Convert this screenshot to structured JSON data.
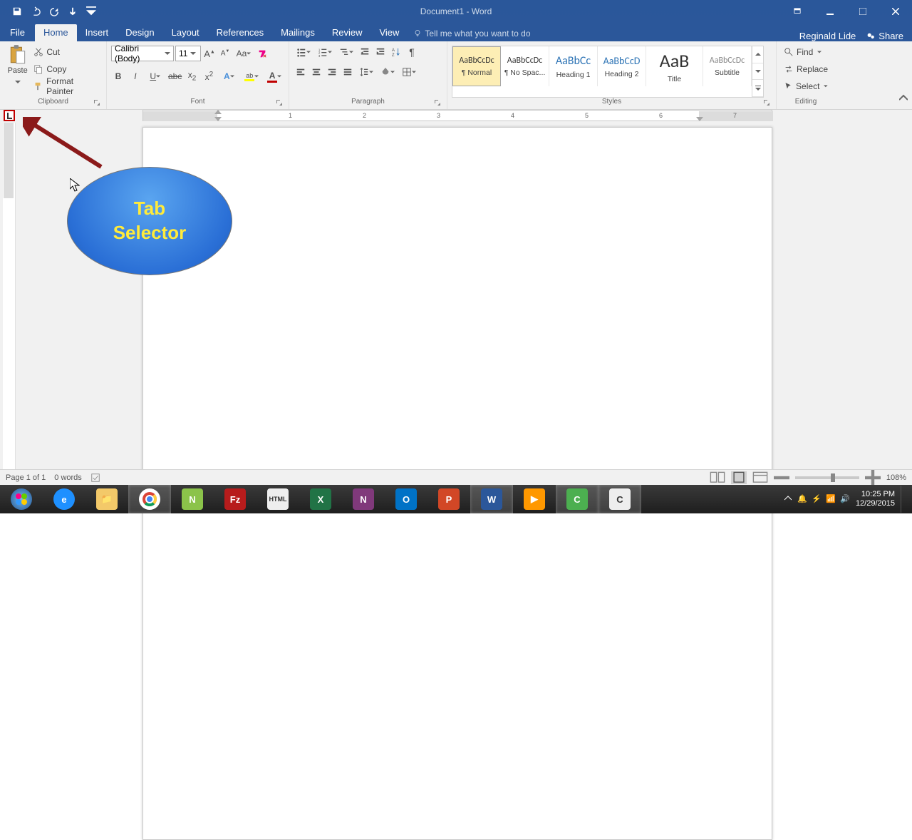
{
  "title": "Document1 - Word",
  "user": "Reginald Lide",
  "share": "Share",
  "tabs": [
    "File",
    "Home",
    "Insert",
    "Design",
    "Layout",
    "References",
    "Mailings",
    "Review",
    "View"
  ],
  "activeTab": "Home",
  "tellme": "Tell me what you want to do",
  "clipboard": {
    "paste": "Paste",
    "cut": "Cut",
    "copy": "Copy",
    "formatPainter": "Format Painter",
    "groupLabel": "Clipboard"
  },
  "font": {
    "name": "Calibri (Body)",
    "size": "11",
    "groupLabel": "Font"
  },
  "paragraph": {
    "groupLabel": "Paragraph"
  },
  "styles": {
    "groupLabel": "Styles",
    "items": [
      {
        "preview": "AaBbCcDc",
        "name": "¶ Normal",
        "size": "12px",
        "color": "#333"
      },
      {
        "preview": "AaBbCcDc",
        "name": "¶ No Spac...",
        "size": "12px",
        "color": "#333"
      },
      {
        "preview": "AaBbCc",
        "name": "Heading 1",
        "size": "15px",
        "color": "#2e74b5"
      },
      {
        "preview": "AaBbCcD",
        "name": "Heading 2",
        "size": "13px",
        "color": "#2e74b5"
      },
      {
        "preview": "AaB",
        "name": "Title",
        "size": "24px",
        "color": "#333"
      },
      {
        "preview": "AaBbCcDc",
        "name": "Subtitle",
        "size": "12px",
        "color": "#888"
      }
    ]
  },
  "editing": {
    "find": "Find",
    "replace": "Replace",
    "select": "Select",
    "groupLabel": "Editing"
  },
  "ruler": {
    "marks": [
      "1",
      "2",
      "3",
      "4",
      "5",
      "6",
      "7"
    ]
  },
  "annotation": {
    "line1": "Tab",
    "line2": "Selector"
  },
  "status": {
    "page": "Page 1 of 1",
    "words": "0 words",
    "zoom": "108%"
  },
  "clock": {
    "time": "10:25 PM",
    "date": "12/29/2015"
  }
}
